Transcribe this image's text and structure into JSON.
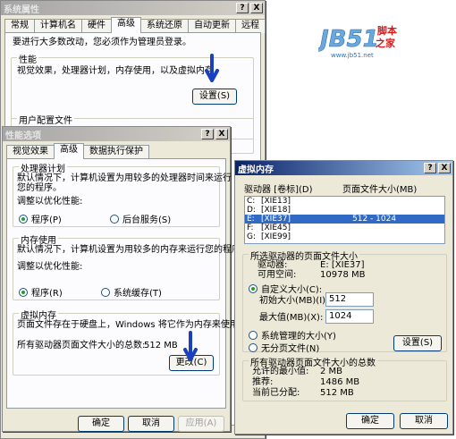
{
  "sysprops": {
    "title": "系统属性",
    "tabs": [
      "常规",
      "计算机名",
      "硬件",
      "高级",
      "系统还原",
      "自动更新",
      "远程"
    ],
    "selected_tab": "高级",
    "admin_note": "要进行大多数改动，您必须作为管理员登录。",
    "performance": {
      "title": "性能",
      "desc": "视觉效果，处理器计划，内存使用，以及虚拟内存",
      "settings_button": "设置(S)"
    },
    "user_profile": {
      "title": "用户配置文件"
    },
    "title_buttons": [
      "?",
      "X"
    ]
  },
  "perf": {
    "title": "性能选项",
    "tabs": [
      "视觉效果",
      "高级",
      "数据执行保护"
    ],
    "selected_tab": "高级",
    "scheduling": {
      "title": "处理器计划",
      "desc_lines": [
        "默认情况下，计算机设置为用较多的处理器时间来运行",
        "您的程序。"
      ],
      "adjust_label": "调整以优化性能:",
      "opt1": "程序(P)",
      "opt2": "后台服务(S)"
    },
    "memory": {
      "title": "内存使用",
      "desc_lines": [
        "默认情况下，计算机设置为用较多的内存来运行您的程序。"
      ],
      "adjust_label": "调整以优化性能:",
      "opt1": "程序(R)",
      "opt2": "系统缓存(T)"
    },
    "vm": {
      "title": "虚拟内存",
      "desc_lines": [
        "页面文件存在于硬盘上，Windows 将它作为内存来使用。"
      ],
      "total_label": "所有驱动器页面文件大小的总数:",
      "total_value": "512 MB",
      "change_button": "更改(C)"
    },
    "buttons": {
      "ok": "确定",
      "cancel": "取消",
      "apply": "应用(A)"
    },
    "title_buttons": [
      "?",
      "X"
    ]
  },
  "vmwin": {
    "title": "虚拟内存",
    "col_drive": "驱动器 [卷标](D)",
    "col_size": "页面文件大小(MB)",
    "drives": [
      {
        "drive": "C:",
        "label": "[XIE13]",
        "size": ""
      },
      {
        "drive": "D:",
        "label": "[XIE18]",
        "size": ""
      },
      {
        "drive": "E:",
        "label": "[XIE37]",
        "size": "512 - 1024",
        "selected": true
      },
      {
        "drive": "F:",
        "label": "[XIE45]",
        "size": ""
      },
      {
        "drive": "G:",
        "label": "[XIE99]",
        "size": ""
      }
    ],
    "selected_group": {
      "title": "所选驱动器的页面文件大小",
      "drive_label": "驱动器:",
      "drive_value": "E:  [XIE37]",
      "space_label": "可用空间:",
      "space_value": "10978 MB",
      "custom_label": "自定义大小(C):",
      "initial_label": "初始大小(MB)(I):",
      "initial_value": "512",
      "max_label": "最大值(MB)(X):",
      "max_value": "1024",
      "system_label": "系统管理的大小(Y)",
      "none_label": "无分页文件(N)",
      "set_button": "设置(S)"
    },
    "total_group": {
      "title": "所有驱动器页面文件大小的总数",
      "min_label": "允许的最小值:",
      "min_value": "2 MB",
      "rec_label": "推荐:",
      "rec_value": "1486 MB",
      "cur_label": "当前已分配:",
      "cur_value": "512 MB"
    },
    "buttons": {
      "ok": "确定",
      "cancel": "取消"
    },
    "title_buttons": [
      "?",
      "X"
    ]
  },
  "watermark": {
    "brand": "JB51",
    "net": ".net",
    "cn1": "脚本",
    "cn2": "之家",
    "url": "www.jb51.net"
  },
  "colors": {
    "xp_bg": "#ece9d8",
    "active_title": "#0a246a",
    "selection": "#316ac5",
    "arrow": "#1a3fbf"
  }
}
